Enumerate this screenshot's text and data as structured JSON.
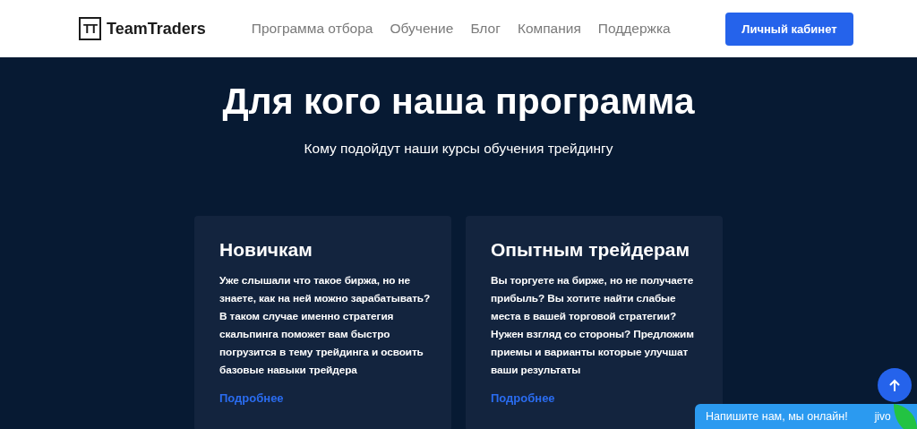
{
  "header": {
    "logo_mark": "TT",
    "logo_text": "TeamTraders",
    "nav": [
      "Программа отбора",
      "Обучение",
      "Блог",
      "Компания",
      "Поддержка"
    ],
    "account_button": "Личный кабинет"
  },
  "hero": {
    "title": "Для кого наша программа",
    "subtitle": "Кому подойдут наши курсы обучения трейдингу"
  },
  "cards": [
    {
      "title": "Новичкам",
      "text": "Уже слышали что такое биржа, но не знаете, как на ней можно зарабатывать? В таком случае именно стратегия скальпинга поможет вам быстро погрузится в тему трейдинга и освоить базовые навыки трейдера",
      "link": "Подробнее"
    },
    {
      "title": "Опытным трейдерам",
      "text": "Вы торгуете на бирже, но не получаете прибыль? Вы хотите найти слабые места в вашей торговой стратегии? Нужен взгляд со стороны? Предложим приемы и варианты которые улучшат ваши результаты",
      "link": "Подробнее"
    }
  ],
  "chat_widget": {
    "text": "Напишите нам, мы онлайн!",
    "brand": "jivo"
  }
}
